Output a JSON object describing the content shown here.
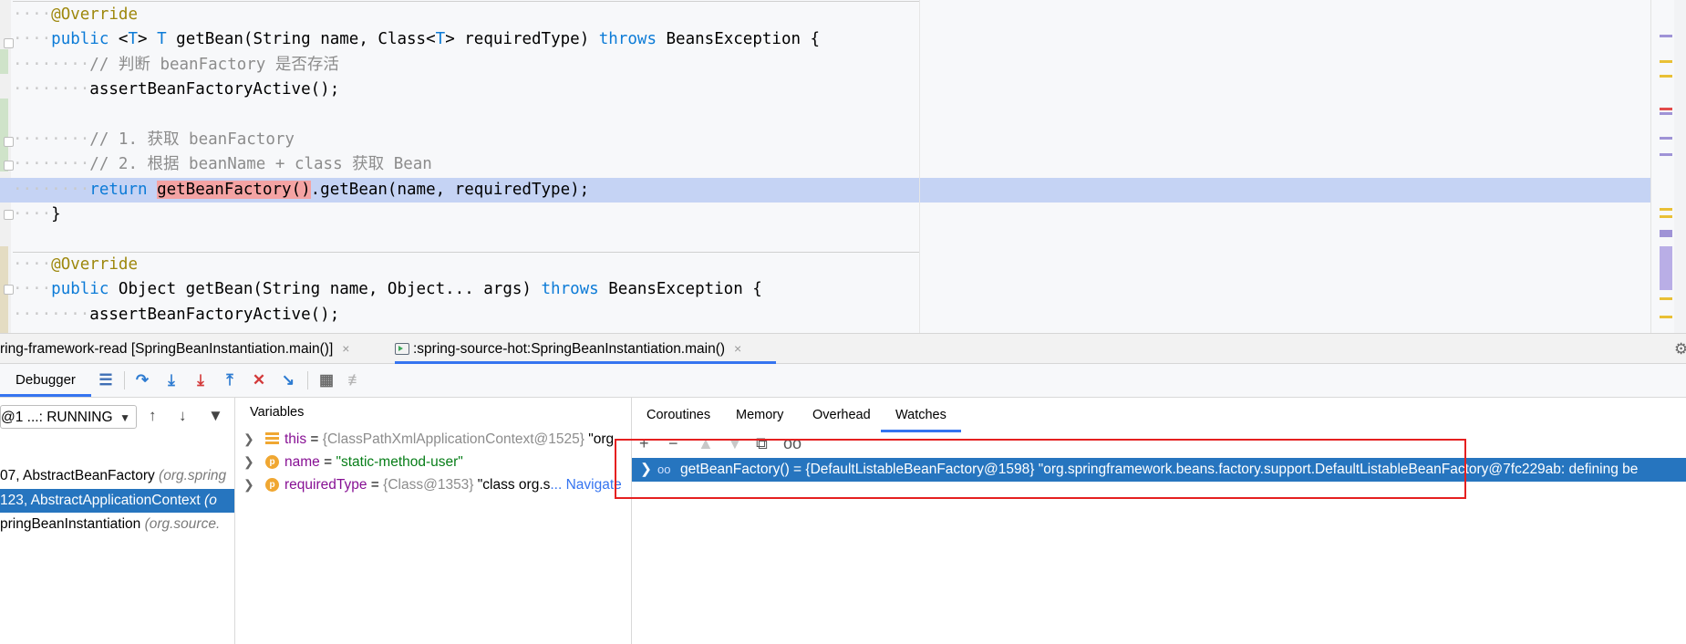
{
  "editor": {
    "lines": [
      {
        "indent": "····",
        "tokens": [
          {
            "t": "@Override",
            "c": "ann"
          }
        ]
      },
      {
        "indent": "····",
        "tokens": [
          {
            "t": "public",
            "c": "kw"
          },
          {
            "t": " <"
          },
          {
            "t": "T",
            "c": "ty"
          },
          {
            "t": "> "
          },
          {
            "t": "T",
            "c": "ty"
          },
          {
            "t": " getBean(String name, Class<"
          },
          {
            "t": "T",
            "c": "ty"
          },
          {
            "t": "> requiredType) "
          },
          {
            "t": "throws",
            "c": "kw"
          },
          {
            "t": " BeansException {"
          }
        ]
      },
      {
        "indent": "········",
        "tokens": [
          {
            "t": "// 判断 beanFactory 是否存活",
            "c": "cm"
          }
        ]
      },
      {
        "indent": "········",
        "tokens": [
          {
            "t": "assertBeanFactoryActive();"
          }
        ]
      },
      {
        "indent": "",
        "tokens": []
      },
      {
        "indent": "········",
        "tokens": [
          {
            "t": "// 1. 获取 beanFactory",
            "c": "cm"
          }
        ]
      },
      {
        "indent": "········",
        "tokens": [
          {
            "t": "// 2. 根据 beanName + class 获取 Bean",
            "c": "cm"
          }
        ]
      },
      {
        "indent": "········",
        "tokens": [
          {
            "t": "return",
            "c": "kw"
          },
          {
            "t": " "
          },
          {
            "t": "getBeanFactory()",
            "c": "err"
          },
          {
            "t": ".getBean(name, requiredType);"
          }
        ],
        "highlight": true
      },
      {
        "indent": "····",
        "tokens": [
          {
            "t": "}"
          }
        ]
      },
      {
        "indent": "",
        "tokens": []
      },
      {
        "indent": "····",
        "tokens": [
          {
            "t": "@Override",
            "c": "ann"
          }
        ]
      },
      {
        "indent": "····",
        "tokens": [
          {
            "t": "public",
            "c": "kw"
          },
          {
            "t": " Object getBean(String name, Object... args) "
          },
          {
            "t": "throws",
            "c": "kw"
          },
          {
            "t": " BeansException {"
          }
        ]
      },
      {
        "indent": "········",
        "tokens": [
          {
            "t": "assertBeanFactoryActive();"
          }
        ]
      }
    ]
  },
  "run_tabs": [
    {
      "label": "ring-framework-read [SpringBeanInstantiation.main()]",
      "close": "×"
    },
    {
      "label": ":spring-source-hot:SpringBeanInstantiation.main()",
      "close": "×"
    }
  ],
  "toolbar": {
    "debugger_tab": "Debugger"
  },
  "frames": {
    "thread": "@1 ...: RUNNING",
    "items": [
      {
        "line": "07, AbstractBeanFactory ",
        "pkg": "(org.spring"
      },
      {
        "line": "123, AbstractApplicationContext ",
        "pkg": "(o"
      },
      {
        "line": "pringBeanInstantiation ",
        "pkg": "(org.source."
      }
    ]
  },
  "variables": {
    "title": "Variables",
    "items": [
      {
        "name": "this",
        "eq": " = ",
        "ref": "{ClassPathXmlApplicationContext@1525}",
        "val": " \"org"
      },
      {
        "name": "name",
        "eq": " = ",
        "str": "\"static-method-user\""
      },
      {
        "name": "requiredType",
        "eq": " = ",
        "ref": "{Class@1353}",
        "val": " \"class org.s",
        "link": "... Navigate"
      }
    ]
  },
  "watches": {
    "tabs": [
      "Coroutines",
      "Memory",
      "Overhead",
      "Watches"
    ],
    "active_tab": "Watches",
    "row": "getBeanFactory() = {DefaultListableBeanFactory@1598} \"org.springframework.beans.factory.support.DefaultListableBeanFactory@7fc229ab: defining be"
  },
  "colors": {
    "accent": "#3574f0",
    "selection": "#2675bf",
    "line_highlight": "#c5d3f4",
    "annotation_box": "#e52020"
  }
}
